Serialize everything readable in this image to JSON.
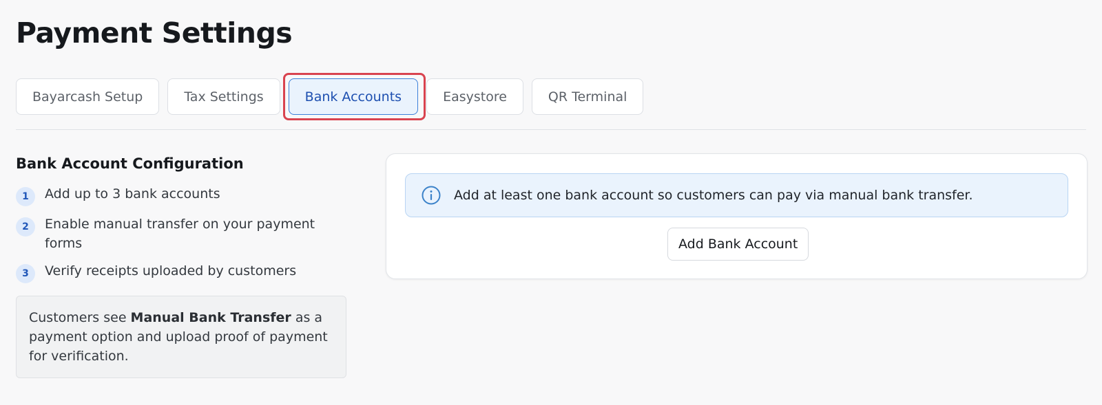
{
  "page": {
    "title": "Payment Settings"
  },
  "tabs": [
    {
      "label": "Bayarcash Setup",
      "active": false
    },
    {
      "label": "Tax Settings",
      "active": false
    },
    {
      "label": "Bank Accounts",
      "active": true
    },
    {
      "label": "Easystore",
      "active": false
    },
    {
      "label": "QR Terminal",
      "active": false
    }
  ],
  "config": {
    "title": "Bank Account Configuration",
    "steps": [
      {
        "num": "1",
        "text": "Add up to 3 bank accounts"
      },
      {
        "num": "2",
        "text": "Enable manual transfer on your payment forms"
      },
      {
        "num": "3",
        "text": "Verify receipts uploaded by customers"
      }
    ],
    "note": {
      "prefix": "Customers see ",
      "bold": "Manual Bank Transfer",
      "suffix": " as a payment option and upload proof of payment for verification."
    }
  },
  "card": {
    "alert_icon": "info-icon",
    "alert_text": "Add at least one bank account so customers can pay via manual bank transfer.",
    "add_button_label": "Add Bank Account"
  },
  "colors": {
    "active_tab_bg": "#eaf3fd",
    "active_tab_text": "#1d4fb0",
    "highlight_border": "#d9434f",
    "info_accent": "#3b82c9"
  }
}
